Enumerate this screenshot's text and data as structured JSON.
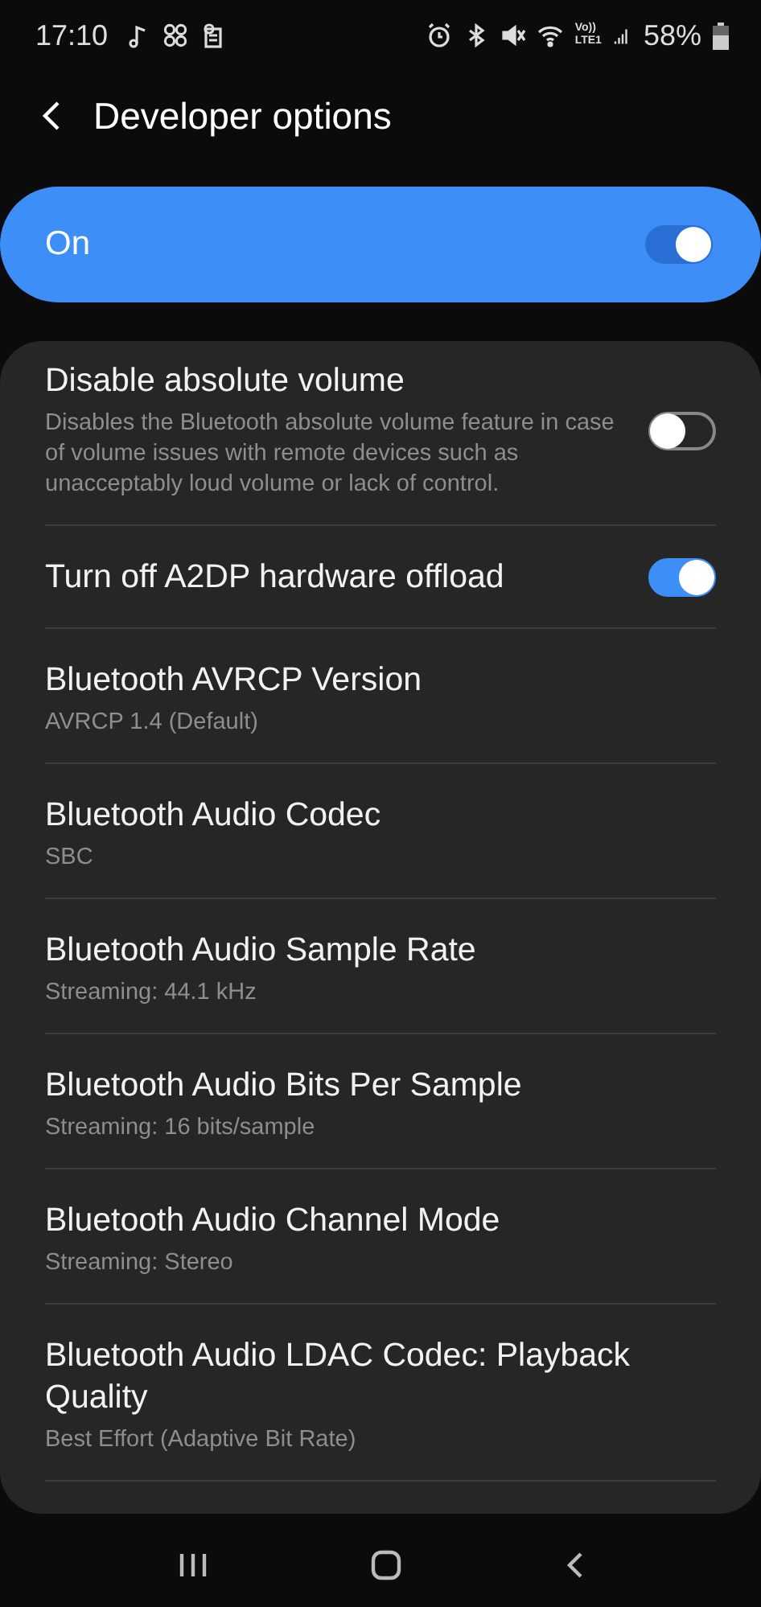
{
  "status_bar": {
    "time": "17:10",
    "network_top": "Vo))",
    "network_bottom": "LTE1",
    "battery": "58%"
  },
  "header": {
    "title": "Developer options"
  },
  "master": {
    "label": "On",
    "on": true
  },
  "settings": [
    {
      "kind": "switch",
      "title": "Disable absolute volume",
      "subtitle": "Disables the Bluetooth absolute volume feature in case of volume issues with remote devices such as unacceptably loud volume or lack of control.",
      "on": false
    },
    {
      "kind": "switch",
      "title": "Turn off A2DP hardware offload",
      "on": true
    },
    {
      "kind": "value",
      "title": "Bluetooth AVRCP Version",
      "subtitle": "AVRCP 1.4 (Default)"
    },
    {
      "kind": "value",
      "title": "Bluetooth Audio Codec",
      "subtitle": "SBC"
    },
    {
      "kind": "value",
      "title": "Bluetooth Audio Sample Rate",
      "subtitle": "Streaming: 44.1 kHz"
    },
    {
      "kind": "value",
      "title": "Bluetooth Audio Bits Per Sample",
      "subtitle": "Streaming: 16 bits/sample"
    },
    {
      "kind": "value",
      "title": "Bluetooth Audio Channel Mode",
      "subtitle": "Streaming: Stereo"
    },
    {
      "kind": "value",
      "title": "Bluetooth Audio LDAC Codec: Playback Quality",
      "subtitle": "Best Effort (Adaptive Bit Rate)"
    }
  ]
}
